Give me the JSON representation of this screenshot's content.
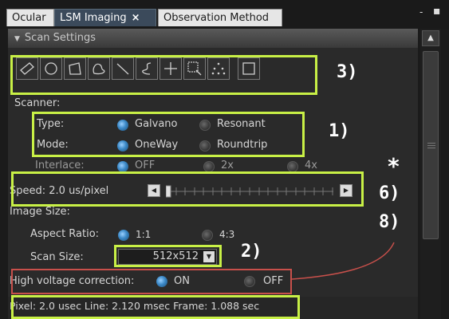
{
  "tabs": [
    {
      "label": "Ocular",
      "active": false
    },
    {
      "label": "LSM Imaging",
      "active": true,
      "close": "×"
    },
    {
      "label": "Observation Method",
      "active": false
    }
  ],
  "window_controls": [
    "-",
    "▪"
  ],
  "section": {
    "title": "Scan Settings"
  },
  "tools": [
    "rectangle-icon",
    "ellipse-icon",
    "polygon-icon",
    "freehand-closed-icon",
    "line-icon",
    "polyline-icon",
    "point-icon",
    "grid-roi-icon",
    "multipoint-icon",
    "square-icon"
  ],
  "scanner": {
    "label": "Scanner:",
    "type_label": "Type:",
    "type_options": [
      {
        "label": "Galvano",
        "selected": true
      },
      {
        "label": "Resonant",
        "selected": false
      }
    ],
    "mode_label": "Mode:",
    "mode_options": [
      {
        "label": "OneWay",
        "selected": true
      },
      {
        "label": "Roundtrip",
        "selected": false
      }
    ],
    "interlace_label": "Interlace:",
    "interlace_options": [
      {
        "label": "OFF",
        "selected": true
      },
      {
        "label": "2x",
        "selected": false
      },
      {
        "label": "4x",
        "selected": false
      }
    ]
  },
  "speed": {
    "label": "Speed: 2.0 us/pixel",
    "position": 0.0
  },
  "image_size": {
    "label": "Image Size:",
    "aspect_label": "Aspect Ratio:",
    "aspect_options": [
      {
        "label": "1:1",
        "selected": true
      },
      {
        "label": "4:3",
        "selected": false
      }
    ],
    "scan_size_label": "Scan Size:",
    "scan_size_value": "512x512"
  },
  "hv_correction": {
    "label": "High voltage correction:",
    "options": [
      {
        "label": "ON",
        "selected": true
      },
      {
        "label": "OFF",
        "selected": false
      }
    ]
  },
  "status_text": "Pixel: 2.0 usec Line: 2.120 msec Frame: 1.088 sec",
  "annotations": {
    "a3": "3)",
    "a1": "1)",
    "star": "*",
    "a6": "6)",
    "a8": "8)",
    "a2": "2)"
  },
  "colors": {
    "annotation_green": "#c8f046",
    "annotation_red": "#c8504b",
    "radio_on": "#3b88c6"
  }
}
